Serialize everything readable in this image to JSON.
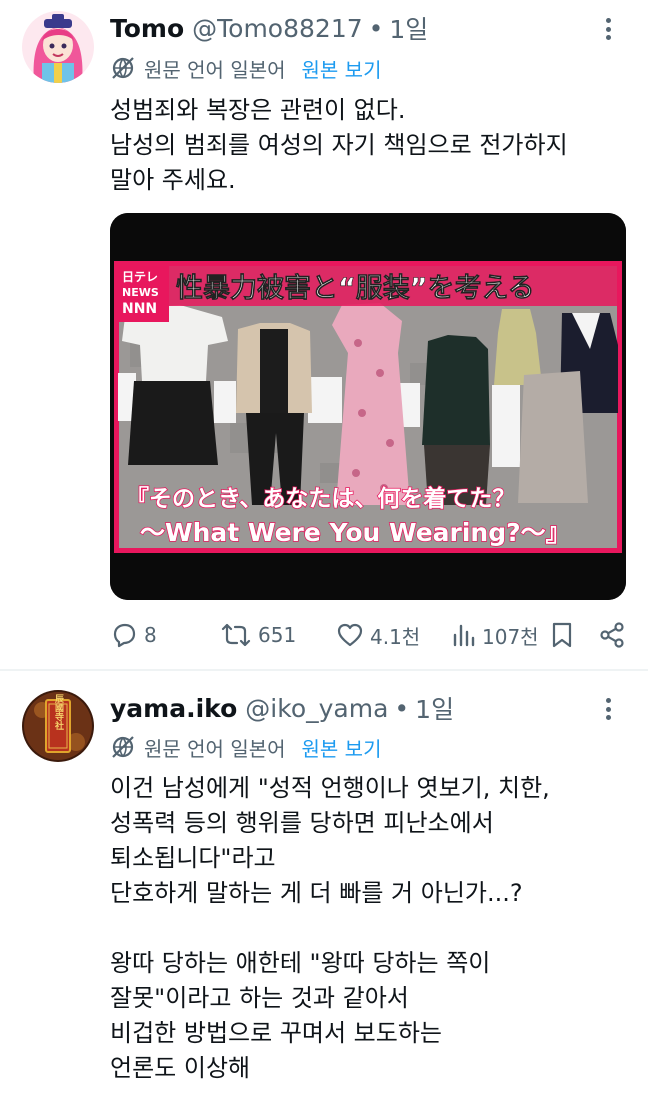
{
  "posts": [
    {
      "name": "Tomo",
      "handle": "@Tomo88217",
      "dot": "•",
      "time": "1일",
      "translate_label": "원문 언어 일본어",
      "view_original": "원본 보기",
      "lines": [
        "성범죄와 복장은 관련이 없다.",
        "남성의 범죄를 여성의 자기 책임으로 전가하지",
        "말아 주세요."
      ],
      "media": {
        "logo_top": "日テレ",
        "logo_mid": "NEWS",
        "logo_bot": "NNN",
        "headline": "性暴力被害と“服装”を考える",
        "caption_line1": "『そのとき、あなたは、何を着てた？",
        "caption_line2": "〜What Were You Wearing?〜』"
      },
      "stats": {
        "replies": "8",
        "reposts": "651",
        "likes": "4.1천",
        "views": "107천"
      }
    },
    {
      "name": "yama.iko",
      "handle": "@iko_yama",
      "dot": "•",
      "time": "1일",
      "translate_label": "원문 언어 일본어",
      "view_original": "원본 보기",
      "avatar_text": "辰國寺社",
      "lines": [
        "이건 남성에게 \"성적 언행이나 엿보기, 치한,",
        "성폭력 등의 행위를 당하면 피난소에서",
        "퇴소됩니다\"라고",
        "단호하게 말하는 게 더 빠를 거 아닌가...?",
        "",
        "왕따 당하는 애한테 \"왕따 당하는 쪽이",
        "잘못\"이라고 하는 것과 같아서",
        "비겁한 방법으로 꾸며서 보도하는",
        "언론도 이상해"
      ]
    }
  ],
  "colors": {
    "text": "#0f1419",
    "secondary": "#536471",
    "link": "#1d9bf0",
    "divider": "#eff3f4",
    "banner_pink": "#e8175d"
  },
  "icons": [
    "globe-slash-icon",
    "more-icon",
    "reply-icon",
    "repost-icon",
    "like-icon",
    "views-icon",
    "bookmark-icon",
    "share-icon"
  ]
}
